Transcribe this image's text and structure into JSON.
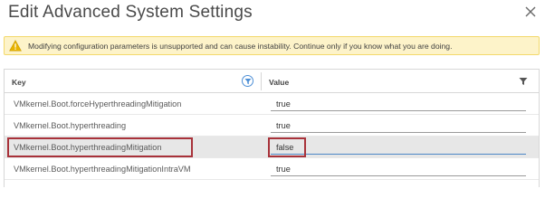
{
  "dialog": {
    "title": "Edit Advanced System Settings"
  },
  "warning": {
    "text": "Modifying configuration parameters is unsupported and can cause instability. Continue only if you know what you are doing."
  },
  "grid": {
    "columns": {
      "key": "Key",
      "value": "Value"
    },
    "rows": [
      {
        "key": "VMkernel.Boot.forceHyperthreadingMitigation",
        "value": "true"
      },
      {
        "key": "VMkernel.Boot.hyperthreading",
        "value": "true"
      },
      {
        "key": "VMkernel.Boot.hyperthreadingMitigation",
        "value": "false"
      },
      {
        "key": "VMkernel.Boot.hyperthreadingMitigationIntraVM",
        "value": "true"
      }
    ]
  },
  "colors": {
    "warning_bg": "#fdf3c9",
    "warning_icon": "#e8b400",
    "highlight": "#a8323a",
    "selected_row": "#e7e7e7",
    "accent": "#4d8fd6"
  }
}
